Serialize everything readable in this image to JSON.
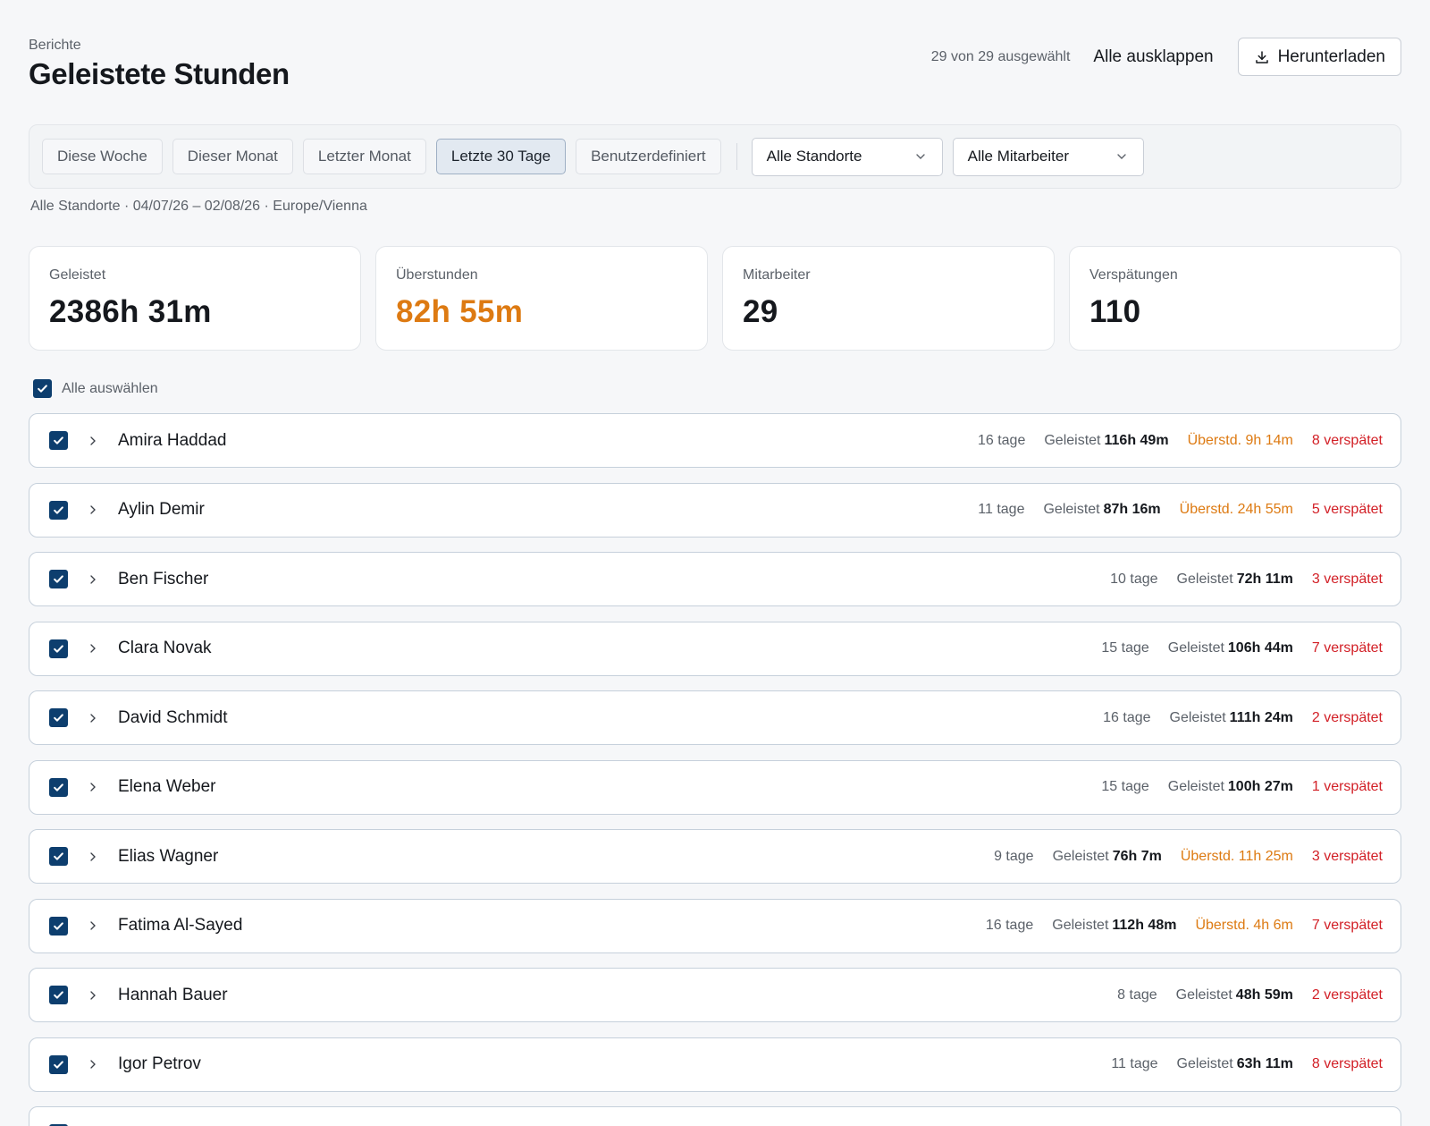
{
  "header": {
    "eyebrow": "Berichte",
    "title": "Geleistete Stunden",
    "selected_count": "29 von 29 ausgewählt",
    "expand_all": "Alle ausklappen",
    "download": "Herunterladen"
  },
  "filters": {
    "chips": [
      "Diese Woche",
      "Dieser Monat",
      "Letzter Monat",
      "Letzte 30 Tage",
      "Benutzerdefiniert"
    ],
    "active_chip": "Letzte 30 Tage",
    "location_select": "Alle Standorte",
    "employee_select": "Alle Mitarbeiter"
  },
  "subtitle": "Alle Standorte · 04/07/26 – 02/08/26 · Europe/Vienna",
  "stats": [
    {
      "label": "Geleistet",
      "value": "2386h 31m"
    },
    {
      "label": "Überstunden",
      "value": "82h 55m"
    },
    {
      "label": "Mitarbeiter",
      "value": "29"
    },
    {
      "label": "Verspätungen",
      "value": "110"
    }
  ],
  "select_all_label": "Alle auswählen",
  "worked_label": "Geleistet",
  "rows": [
    {
      "name": "Amira Haddad",
      "days": "16 tage",
      "worked": "116h 49m",
      "overtime": "Überstd. 9h 14m",
      "late": "8 verspätet"
    },
    {
      "name": "Aylin Demir",
      "days": "11 tage",
      "worked": "87h 16m",
      "overtime": "Überstd. 24h 55m",
      "late": "5 verspätet"
    },
    {
      "name": "Ben Fischer",
      "days": "10 tage",
      "worked": "72h 11m",
      "overtime": "",
      "late": "3 verspätet"
    },
    {
      "name": "Clara Novak",
      "days": "15 tage",
      "worked": "106h 44m",
      "overtime": "",
      "late": "7 verspätet"
    },
    {
      "name": "David Schmidt",
      "days": "16 tage",
      "worked": "111h 24m",
      "overtime": "",
      "late": "2 verspätet"
    },
    {
      "name": "Elena Weber",
      "days": "15 tage",
      "worked": "100h 27m",
      "overtime": "",
      "late": "1 verspätet"
    },
    {
      "name": "Elias Wagner",
      "days": "9 tage",
      "worked": "76h 7m",
      "overtime": "Überstd. 11h 25m",
      "late": "3 verspätet"
    },
    {
      "name": "Fatima Al-Sayed",
      "days": "16 tage",
      "worked": "112h 48m",
      "overtime": "Überstd. 4h 6m",
      "late": "7 verspätet"
    },
    {
      "name": "Hannah Bauer",
      "days": "8 tage",
      "worked": "48h 59m",
      "overtime": "",
      "late": "2 verspätet"
    },
    {
      "name": "Igor Petrov",
      "days": "11 tage",
      "worked": "63h 11m",
      "overtime": "",
      "late": "8 verspätet"
    },
    {
      "name": "",
      "days": "",
      "worked": "",
      "overtime": "",
      "late": ""
    }
  ],
  "colors": {
    "accent": "#0d3e6e",
    "overtime": "#dd7a12",
    "late": "#d21f26"
  },
  "icons": [
    "download-icon",
    "chevron-down-icon",
    "chevron-right-icon",
    "check-icon"
  ]
}
